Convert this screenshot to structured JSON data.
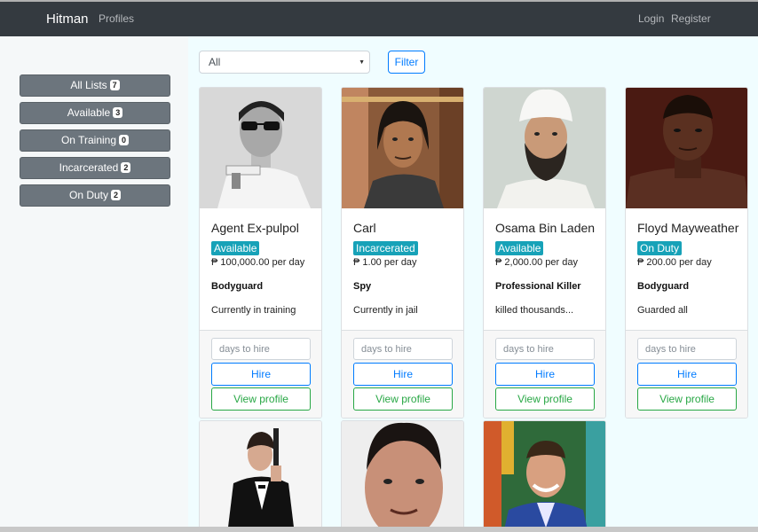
{
  "navbar": {
    "brand": "Hitman",
    "profiles": "Profiles",
    "login": "Login",
    "register": "Register"
  },
  "sidebar": {
    "items": [
      {
        "label": "All Lists",
        "count": "7"
      },
      {
        "label": "Available",
        "count": "3"
      },
      {
        "label": "On Training",
        "count": "0"
      },
      {
        "label": "Incarcerated",
        "count": "2"
      },
      {
        "label": "On Duty",
        "count": "2"
      }
    ]
  },
  "filter": {
    "selected": "All",
    "button_label": "Filter"
  },
  "card_actions": {
    "placeholder": "days to hire",
    "hire_label": "Hire",
    "view_label": "View profile"
  },
  "cards": [
    {
      "name": "Agent Ex-pulpol",
      "status": "Available",
      "price": "₱ 100,000.00 per day",
      "role": "Bodyguard",
      "description": "Currently in training",
      "image": "man-with-sunglasses-and-gun-photo"
    },
    {
      "name": "Carl",
      "status": "Incarcerated",
      "price": "₱ 1.00 per day",
      "role": "Spy",
      "description": "Currently in jail",
      "image": "long-haired-man-photo"
    },
    {
      "name": "Osama Bin Laden",
      "status": "Available",
      "price": "₱ 2,000.00 per day",
      "role": "Professional Killer",
      "description": "killed thousands...",
      "image": "bearded-man-in-turban-photo"
    },
    {
      "name": "Floyd Mayweather",
      "status": "On Duty",
      "price": "₱ 200.00 per day",
      "role": "Bodyguard",
      "description": "Guarded all",
      "image": "boxer-portrait-photo"
    },
    {
      "image": "man-in-tuxedo-with-gun-photo"
    },
    {
      "image": "man-portrait-closeup-photo"
    },
    {
      "image": "smiling-man-in-suit-photo"
    }
  ]
}
